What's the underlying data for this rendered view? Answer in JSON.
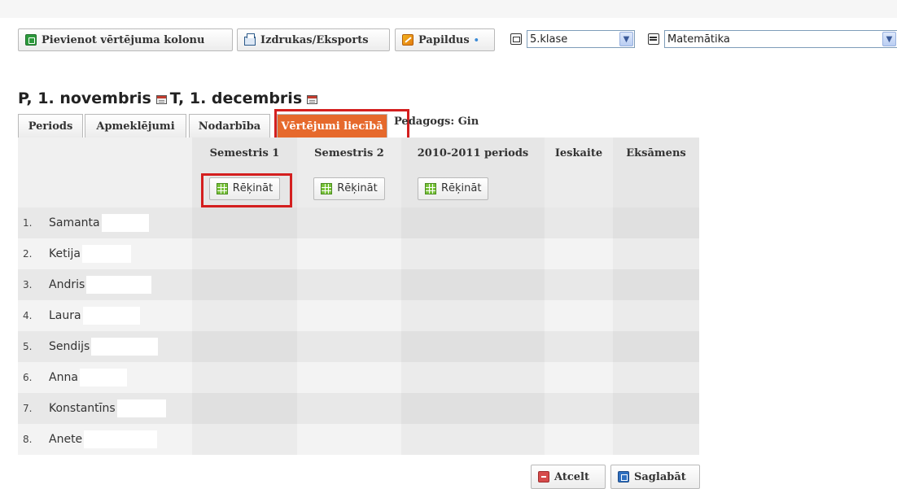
{
  "toolbar": {
    "add_column_label": "Pievienot vērtējuma kolonu",
    "print_export_label": "Izdrukas/Eksports",
    "extra_label": "Papildus",
    "extra_dot": "•",
    "class_select_value": "5.klase",
    "subject_select_value": "Matemātika"
  },
  "date_range": {
    "start": "P, 1. novembris",
    "end": "T, 1. decembris"
  },
  "tabs": [
    {
      "label": "Periods"
    },
    {
      "label": "Apmeklējumi"
    },
    {
      "label": "Nodarbība"
    },
    {
      "label": "Vērtējumi liecībā",
      "active": true
    }
  ],
  "teacher_label": "Pedagogs: Gin",
  "table": {
    "columns": [
      "Semestris 1",
      "Semestris 2",
      "2010-2011 periods",
      "Ieskaite",
      "Eksāmens"
    ],
    "calc_label": "Rēķināt",
    "students": [
      {
        "num": "1.",
        "name": "Samanta"
      },
      {
        "num": "2.",
        "name": "Ketija"
      },
      {
        "num": "3.",
        "name": "Andris"
      },
      {
        "num": "4.",
        "name": "Laura"
      },
      {
        "num": "5.",
        "name": "Sendijs"
      },
      {
        "num": "6.",
        "name": "Anna"
      },
      {
        "num": "7.",
        "name": "Konstantīns"
      },
      {
        "num": "8.",
        "name": "Anete"
      }
    ]
  },
  "footer": {
    "cancel_label": "Atcelt",
    "save_label": "Saglabāt"
  },
  "colors": {
    "active_tab": "#e6692c",
    "highlight": "#d41f1f",
    "row_light": "#f3f3f3",
    "row_dark": "#e8e8e8",
    "col_shade": "#e2e2e2"
  }
}
